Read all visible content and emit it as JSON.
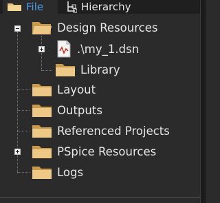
{
  "tabs": [
    {
      "label": "File",
      "icon": "folder-icon",
      "active": true
    },
    {
      "label": "Hierarchy",
      "icon": "hierarchy-icon",
      "active": false
    }
  ],
  "tree": {
    "root": {
      "label": "Design Resources",
      "expanded": true
    },
    "design_file": {
      "label": ".\\my_1.dsn",
      "expanded": false
    },
    "library": {
      "label": "Library"
    },
    "layout": {
      "label": "Layout"
    },
    "outputs": {
      "label": "Outputs"
    },
    "referenced_projects": {
      "label": "Referenced Projects"
    },
    "pspice_resources": {
      "label": "PSpice Resources",
      "expanded": false
    },
    "logs": {
      "label": "Logs"
    }
  },
  "colors": {
    "folder": "#e8c27a",
    "accent": "#4a9be8",
    "background": "#2b2b2b"
  }
}
